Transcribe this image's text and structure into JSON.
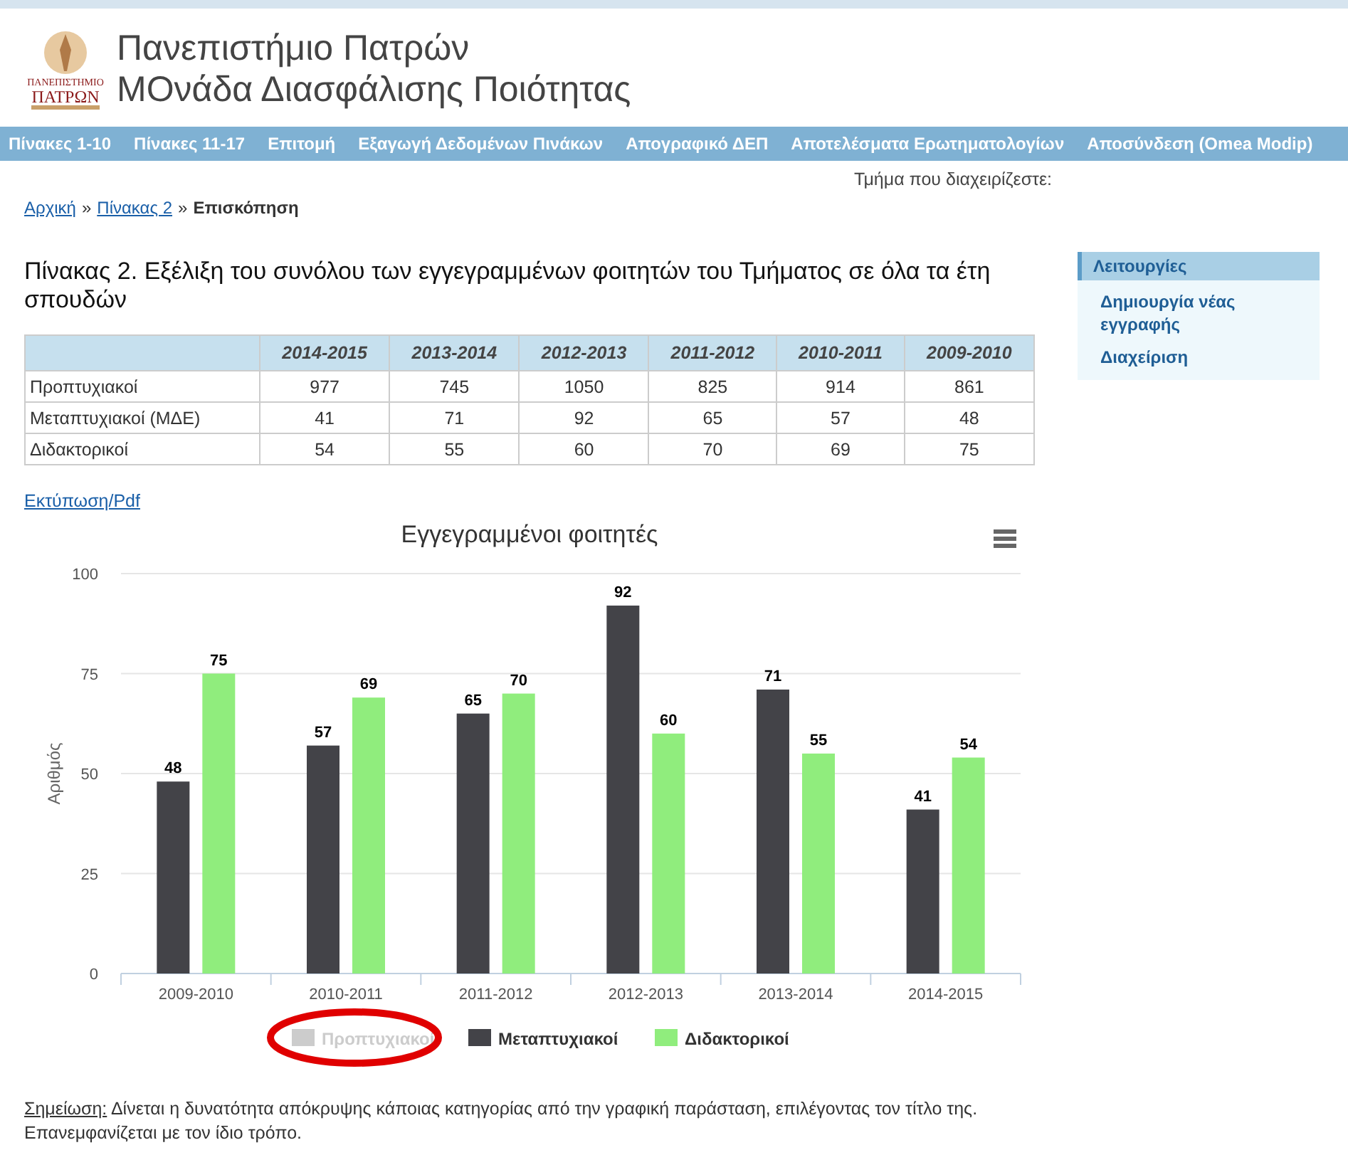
{
  "header": {
    "logo_text": [
      "ΠΑΝΕΠΙΣΤΗΜΙΟ",
      "ΠΑΤΡΩΝ"
    ],
    "title_lines": [
      "Πανεπιστήμιο Πατρών",
      "ΜΟνάδα Διασφάλισης Ποιότητας"
    ]
  },
  "nav": [
    "Πίνακες 1-10",
    "Πίνακες 11-17",
    "Επιτομή",
    "Εξαγωγή Δεδομένων Πινάκων",
    "Απογραφικό ΔΕΠ",
    "Αποτελέσματα Ερωτηματολογίων",
    "Αποσύνδεση (Omea Modip)"
  ],
  "department_label": "Τμήμα που διαχειρίζεστε:",
  "breadcrumb": [
    {
      "label": "Αρχική",
      "kind": "link"
    },
    {
      "label": "Πίνακας 2",
      "kind": "link"
    },
    {
      "label": "Επισκόπηση",
      "kind": "current"
    }
  ],
  "breadcrumb_separator": "»",
  "heading": "Πίνακας 2. Εξέλιξη του συνόλου των εγγεγραμμένων φοιτητών του Τμήματος σε όλα τα έτη σπουδών",
  "table": {
    "columns": [
      "2014-2015",
      "2013-2014",
      "2012-2013",
      "2011-2012",
      "2010-2011",
      "2009-2010"
    ],
    "rows": [
      {
        "label": "Προπτυχιακοί",
        "cells": [
          "977",
          "745",
          "1050",
          "825",
          "914",
          "861"
        ]
      },
      {
        "label": "Μεταπτυχιακοί (ΜΔΕ)",
        "cells": [
          "41",
          "71",
          "92",
          "65",
          "57",
          "48"
        ]
      },
      {
        "label": "Διδακτορικοί",
        "cells": [
          "54",
          "55",
          "60",
          "70",
          "69",
          "75"
        ]
      }
    ]
  },
  "print_link": "Εκτύπωση/Pdf",
  "chart": {
    "chart_data": {
      "type": "bar",
      "title": "Εγγεγραμμένοι φοιτητές",
      "ylabel": "Αριθμός",
      "categories": [
        "2009-2010",
        "2010-2011",
        "2011-2012",
        "2012-2013",
        "2013-2014",
        "2014-2015"
      ],
      "series": [
        {
          "name": "Προπτυχιακοί",
          "color": "#cccccc",
          "values": [
            null,
            null,
            null,
            null,
            null,
            null
          ]
        },
        {
          "name": "Μεταπτυχιακοί",
          "color": "#434348",
          "values": [
            48,
            57,
            65,
            92,
            71,
            41
          ]
        },
        {
          "name": "Διδακτορικοί",
          "color": "#90ed7d",
          "values": [
            75,
            69,
            70,
            60,
            55,
            54
          ]
        }
      ],
      "ylim": [
        0,
        100
      ],
      "yticks": [
        0,
        25,
        50,
        75,
        100
      ],
      "data_labels": true,
      "grid": true,
      "legend": "bottom"
    }
  },
  "note": {
    "label": "Σημείωση:",
    "text": "Δίνεται η δυνατότητα απόκρυψης κάποιας κατηγορίας από την γραφική παράσταση, επιλέγοντας τον τίτλο της. Επανεμφανίζεται με τον ίδιο τρόπο."
  },
  "sidebar": {
    "title": "Λειτουργίες",
    "items": [
      "Δημιουργία νέας εγγραφής",
      "Διαχείριση"
    ]
  }
}
